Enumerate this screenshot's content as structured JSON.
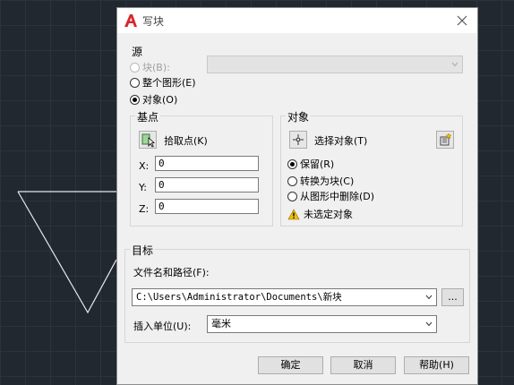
{
  "dialog": {
    "title": "写块",
    "source": {
      "label": "源",
      "block_option": "块(B):",
      "whole_drawing_option": "整个图形(E)",
      "objects_option": "对象(O)"
    },
    "base_point": {
      "label": "基点",
      "pick_point": "拾取点(K)",
      "x_label": "X:",
      "x_value": "0",
      "y_label": "Y:",
      "y_value": "0",
      "z_label": "Z:",
      "z_value": "0"
    },
    "objects": {
      "label": "对象",
      "select_objects": "选择对象(T)",
      "retain": "保留(R)",
      "convert_to_block": "转换为块(C)",
      "delete_from_drawing": "从图形中删除(D)",
      "warning": "未选定对象"
    },
    "destination": {
      "label": "目标",
      "file_path_label": "文件名和路径(F):",
      "file_path_value": "C:\\Users\\Administrator\\Documents\\新块",
      "browse_label": "...",
      "insert_units_label": "插入单位(U):",
      "insert_units_value": "毫米"
    },
    "buttons": {
      "ok": "确定",
      "cancel": "取消",
      "help": "帮助(H)"
    }
  },
  "colors": {
    "canvas": "#212830",
    "dialog": "#f0f0f0",
    "logo_red": "#d9262c",
    "warning_yellow": "#f2c200"
  }
}
